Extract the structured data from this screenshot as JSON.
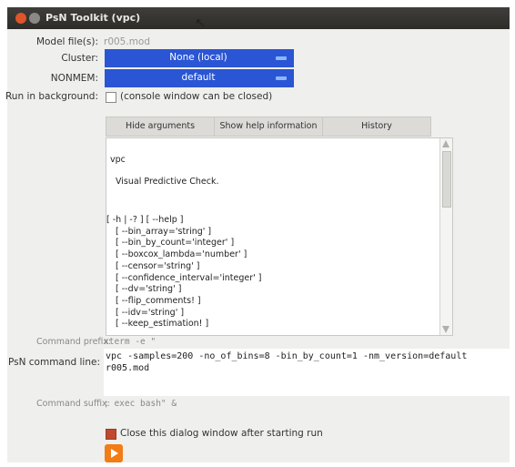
{
  "window": {
    "title": "PsN Toolkit (vpc)"
  },
  "form": {
    "model_label": "Model file(s):",
    "model_value": "r005.mod",
    "cluster_label": "Cluster:",
    "cluster_value": "None (local)",
    "nonmem_label": "NONMEM:",
    "nonmem_value": "default",
    "background_label": "Run in background:",
    "background_note": "(console window can be closed)"
  },
  "buttons": {
    "hide_arguments": "Hide arguments",
    "show_help": "Show help information",
    "history": "History"
  },
  "help": {
    "name": "vpc",
    "description": "Visual Predictive Check.",
    "options": [
      "[ -h | -? ] [ --help ]",
      "[ --bin_array='string' ]",
      "[ --bin_by_count='integer' ]",
      "[ --boxcox_lambda='number' ]",
      "[ --censor='string' ]",
      "[ --confidence_interval='integer' ]",
      "[ --dv='string' ]",
      "[ --flip_comments! ]",
      "[ --idv='string' ]",
      "[ --keep_estimation! ]"
    ]
  },
  "command": {
    "prefix_label": "Command prefix:",
    "prefix_value": "xterm -e \"",
    "line_label": "PsN command line:",
    "line_value": "vpc -samples=200 -no_of_bins=8 -bin_by_count=1 -nm_version=default\nr005.mod",
    "suffix_label": "Command suffix:",
    "suffix_value": "; exec bash\" &"
  },
  "footer": {
    "close_label": "Close this dialog window after starting run"
  },
  "colors": {
    "combo_blue": "#2a55d4",
    "run_orange": "#f27c16",
    "checkbox_red": "#c0482f"
  }
}
